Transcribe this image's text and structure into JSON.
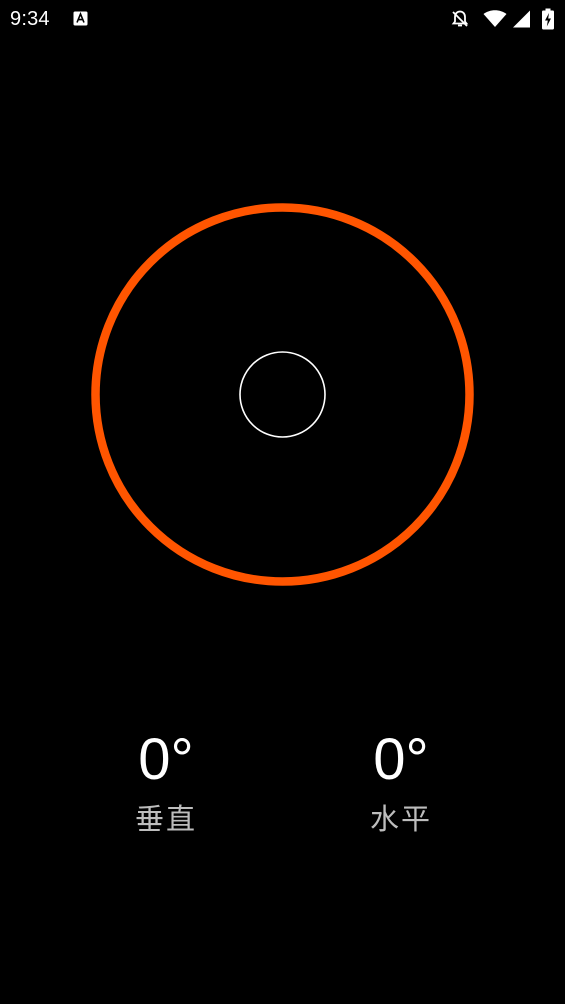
{
  "status_bar": {
    "time": "9:34",
    "icons": [
      "app-notification-icon",
      "notifications-off-icon",
      "wifi-icon",
      "cellular-signal-icon",
      "battery-charging-icon"
    ]
  },
  "level": {
    "vertical_angle_deg": 0,
    "horizontal_angle_deg": 0,
    "ring_color": "#ff5500",
    "bubble_color": "#ffffff"
  },
  "readouts": {
    "vertical": {
      "value": "0°",
      "label": "垂直"
    },
    "horizontal": {
      "value": "0°",
      "label": "水平"
    }
  }
}
